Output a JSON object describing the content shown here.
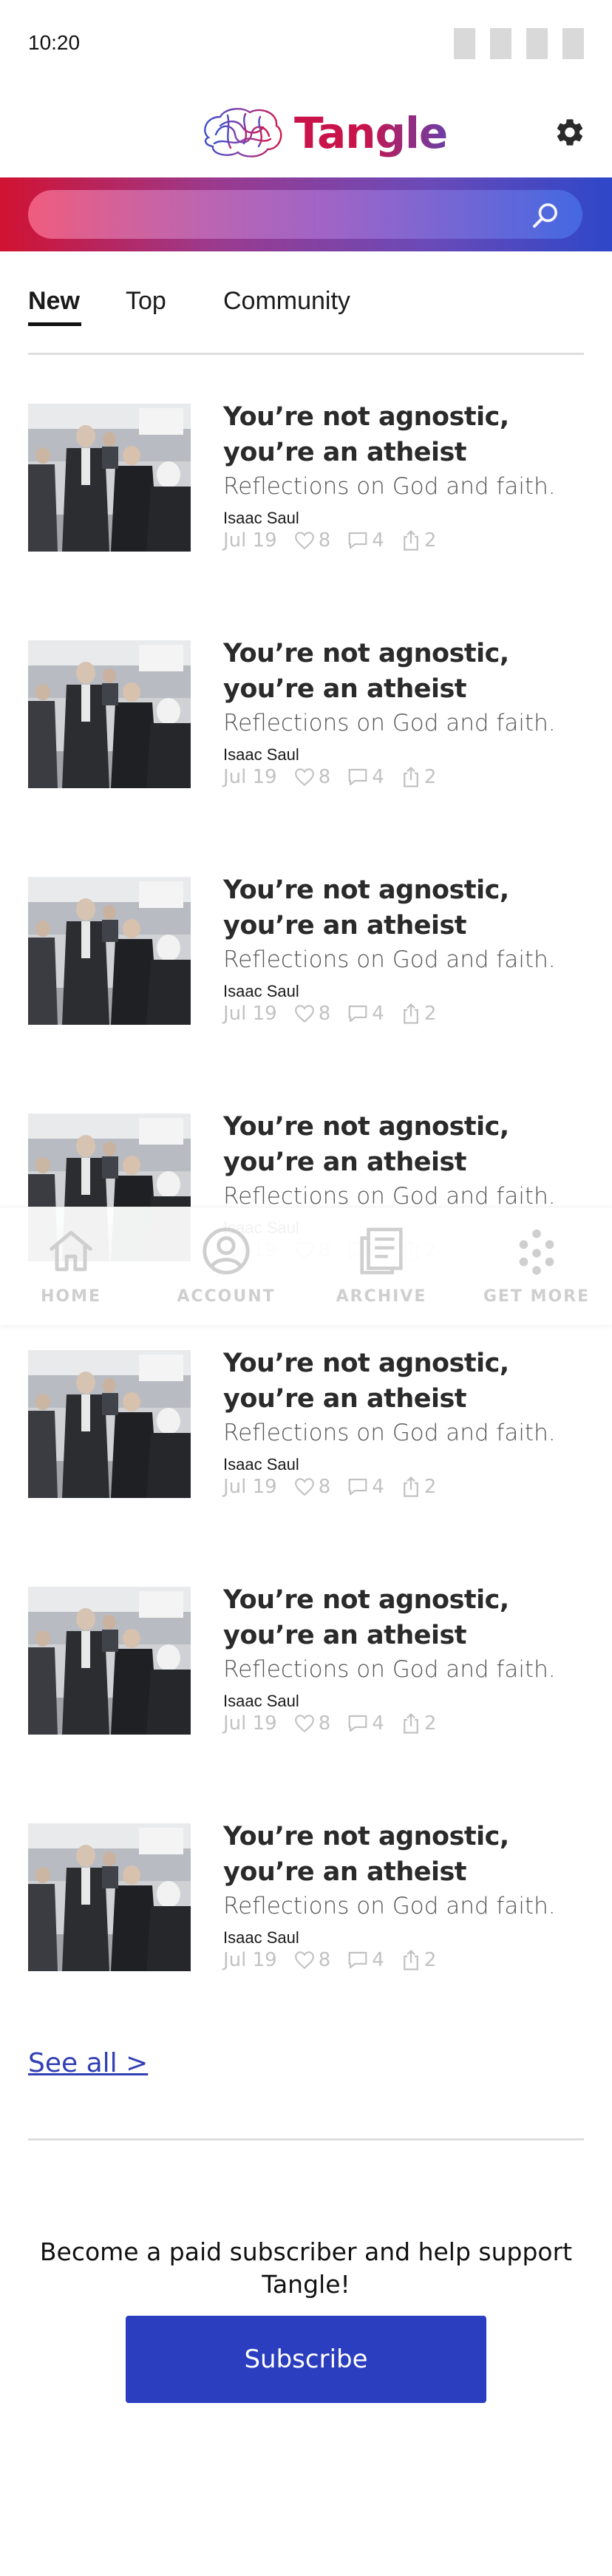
{
  "status_bar": {
    "time": "10:20"
  },
  "brand": {
    "name": "Tangle",
    "colors": {
      "gradient_start": "#d11232",
      "gradient_mid": "#a066c9",
      "gradient_end": "#2e47c8",
      "text_red": "#c9144b",
      "text_purple": "#6b3fa8",
      "primary_button": "#2b3ec0",
      "link": "#3340b3"
    }
  },
  "header": {
    "settings_icon": "gear-icon"
  },
  "search": {
    "placeholder": "",
    "icon": "search-icon"
  },
  "tabs": [
    {
      "label": "New",
      "active": true
    },
    {
      "label": "Top",
      "active": false
    },
    {
      "label": "Community",
      "active": false
    }
  ],
  "articles": [
    {
      "title": "You’re not agnostic, you’re an atheist",
      "subtitle": "Reflections on God and faith.",
      "author": "Isaac Saul",
      "date": "Jul 19",
      "likes": "8",
      "comments": "4",
      "shares": "2"
    },
    {
      "title": "You’re not agnostic, you’re an atheist",
      "subtitle": "Reflections on God and faith.",
      "author": "Isaac Saul",
      "date": "Jul 19",
      "likes": "8",
      "comments": "4",
      "shares": "2"
    },
    {
      "title": "You’re not agnostic, you’re an atheist",
      "subtitle": "Reflections on God and faith.",
      "author": "Isaac Saul",
      "date": "Jul 19",
      "likes": "8",
      "comments": "4",
      "shares": "2"
    },
    {
      "title": "You’re not agnostic, you’re an atheist",
      "subtitle": "Reflections on God and faith.",
      "author": "Isaac Saul",
      "date": "Jul 19",
      "likes": "8",
      "comments": "4",
      "shares": "2"
    },
    {
      "title": "You’re not agnostic, you’re an atheist",
      "subtitle": "Reflections on God and faith.",
      "author": "Isaac Saul",
      "date": "Jul 19",
      "likes": "8",
      "comments": "4",
      "shares": "2"
    },
    {
      "title": "You’re not agnostic, you’re an atheist",
      "subtitle": "Reflections on God and faith.",
      "author": "Isaac Saul",
      "date": "Jul 19",
      "likes": "8",
      "comments": "4",
      "shares": "2"
    },
    {
      "title": "You’re not agnostic, you’re an atheist",
      "subtitle": "Reflections on God and faith.",
      "author": "Isaac Saul",
      "date": "Jul 19",
      "likes": "8",
      "comments": "4",
      "shares": "2"
    }
  ],
  "bottom_nav": [
    {
      "label": "HOME",
      "icon": "home-icon"
    },
    {
      "label": "ACCOUNT",
      "icon": "account-icon"
    },
    {
      "label": "ARCHIVE",
      "icon": "archive-icon"
    },
    {
      "label": "GET MORE",
      "icon": "grid-dots-icon"
    }
  ],
  "footer": {
    "see_all": "See all >",
    "cta": "Become a paid subscriber and help support Tangle!",
    "subscribe_label": "Subscribe"
  }
}
